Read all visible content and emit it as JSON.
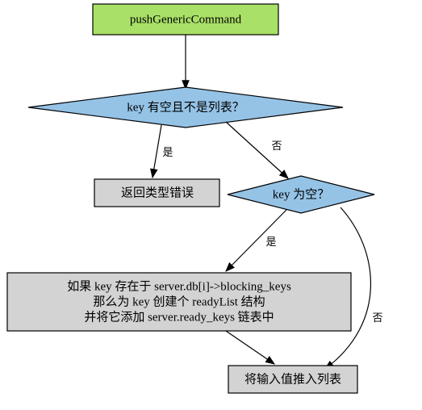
{
  "nodes": {
    "start": {
      "label": "pushGenericCommand"
    },
    "decision1": {
      "label": "key 有空且不是列表？"
    },
    "decision1_yes": "是",
    "decision1_no": "否",
    "error": {
      "label": "返回类型错误"
    },
    "decision2": {
      "label": "key 为空？"
    },
    "decision2_yes": "是",
    "decision2_no": "否",
    "action": {
      "line1": "如果 key 存在于 server.db[i]->blocking_keys",
      "line2": "那么为 key 创建个 readyList 结构",
      "line3": "并将它添加 server.ready_keys 链表中"
    },
    "end": {
      "label": "将输入值推入列表"
    }
  }
}
